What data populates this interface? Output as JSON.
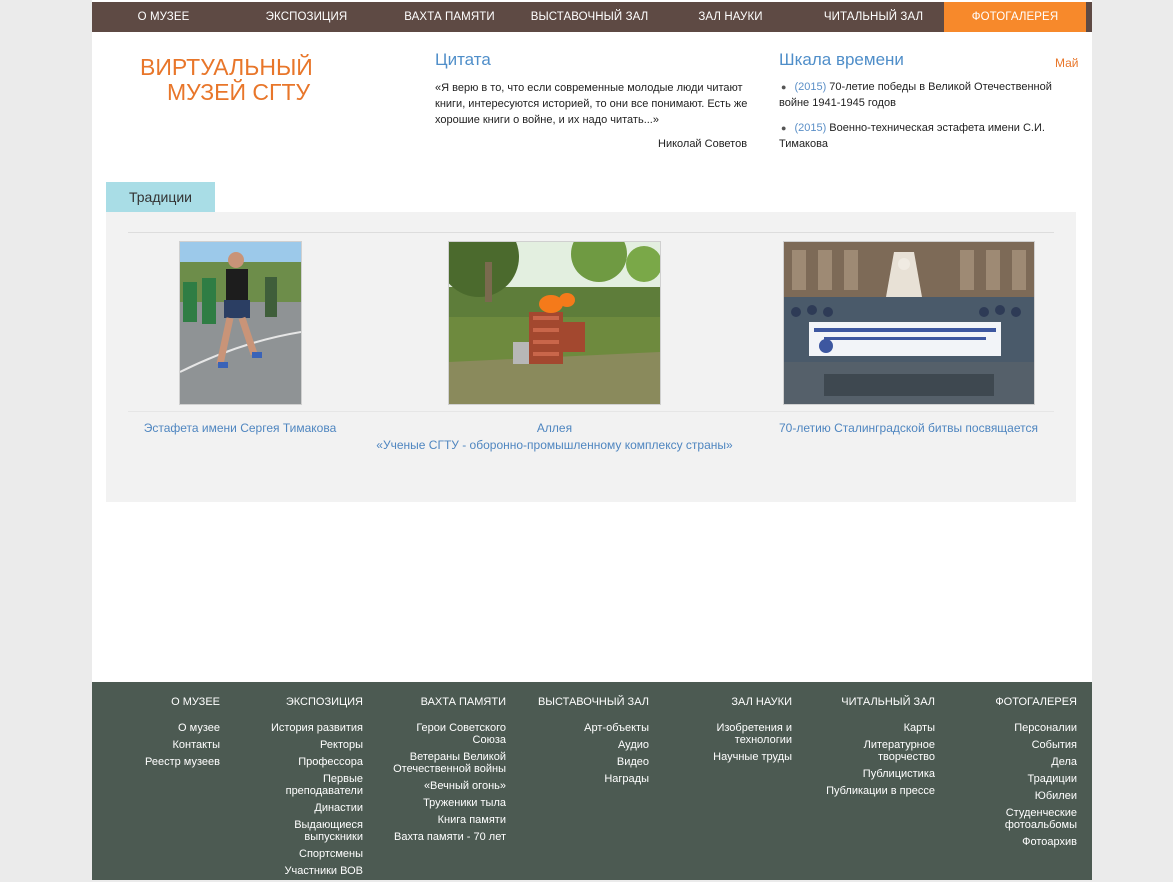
{
  "nav": {
    "items": [
      {
        "label": "О МУЗЕЕ"
      },
      {
        "label": "ЭКСПОЗИЦИЯ"
      },
      {
        "label": "ВАХТА ПАМЯТИ"
      },
      {
        "label": "ВЫСТАВОЧНЫЙ ЗАЛ"
      },
      {
        "label": "ЗАЛ НАУКИ"
      },
      {
        "label": "ЧИТАЛЬНЫЙ ЗАЛ"
      },
      {
        "label": "ФОТОГАЛЕРЕЯ"
      }
    ],
    "active_index": 6,
    "bar_color": "#5e4a44",
    "active_color": "#f7892b"
  },
  "logo": {
    "line1": "ВИРТУАЛЬНЫЙ",
    "line2": "МУЗЕЙ СГТУ"
  },
  "quote": {
    "title": "Цитата",
    "text": "«Я верю в то, что если современные молодые люди читают книги, интересуются историей, то они все понимают. Есть же хорошие книги о войне, и их надо читать...»",
    "author": "Николай Советов"
  },
  "timeline": {
    "title": "Шкала времени",
    "month": "Май",
    "items": [
      {
        "year": "(2015)",
        "text": "70-летие победы в Великой Отечественной войне 1941-1945 годов"
      },
      {
        "year": "(2015)",
        "text": "Военно-техническая эстафета имени С.И. Тимакова"
      }
    ]
  },
  "gallery": {
    "tab_label": "Традиции",
    "items": [
      {
        "caption_line1": "Эстафета имени Сергея Тимакова",
        "caption_line2": ""
      },
      {
        "caption_line1": "Аллея",
        "caption_line2": "«Ученые СГТУ - оборонно-промышленному комплексу страны»"
      },
      {
        "caption_line1": "70-летию Сталинградской битвы посвящается",
        "caption_line2": ""
      }
    ]
  },
  "footer": {
    "columns": [
      {
        "heading": "О МУЗЕЕ",
        "links": [
          "О музее",
          "Контакты",
          "Реестр музеев"
        ]
      },
      {
        "heading": "ЭКСПОЗИЦИЯ",
        "links": [
          "История развития",
          "Ректоры",
          "Профессора",
          "Первые преподаватели",
          "Династии",
          "Выдающиеся выпускники",
          "Спортсмены",
          "Участники ВОВ"
        ]
      },
      {
        "heading": "ВАХТА ПАМЯТИ",
        "links": [
          "Герои Советского Союза",
          "Ветераны Великой Отечественной войны",
          "«Вечный огонь»",
          "Труженики тыла",
          "Книга памяти",
          "Вахта памяти - 70 лет"
        ]
      },
      {
        "heading": "ВЫСТАВОЧНЫЙ ЗАЛ",
        "links": [
          "Арт-объекты",
          "Аудио",
          "Видео",
          "Награды"
        ]
      },
      {
        "heading": "ЗАЛ НАУКИ",
        "links": [
          "Изобретения и технологии",
          "Научные труды"
        ]
      },
      {
        "heading": "ЧИТАЛЬНЫЙ ЗАЛ",
        "links": [
          "Карты",
          "Литературное творчество",
          "Публицистика",
          "Публикации в прессе"
        ]
      },
      {
        "heading": "ФОТОГАЛЕРЕЯ",
        "links": [
          "Персоналии",
          "События",
          "Дела",
          "Традиции",
          "Юбилеи",
          "Студенческие фотоальбомы",
          "Фотоархив"
        ]
      }
    ],
    "bg_color": "#4c5a52"
  }
}
